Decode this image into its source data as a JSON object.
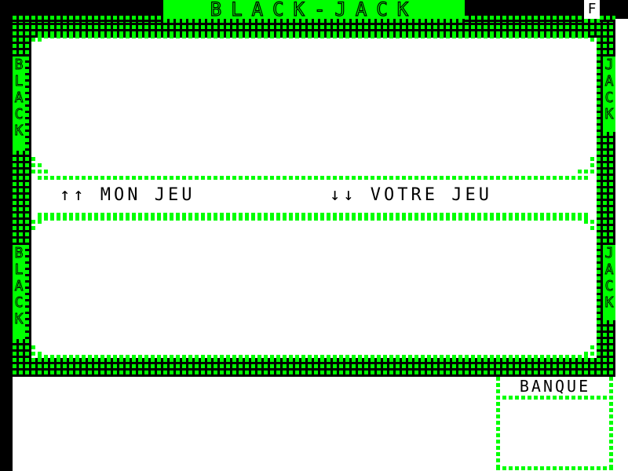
{
  "title": "BLACK-JACK",
  "corner_key": "F",
  "side_label_left": [
    "B",
    "L",
    "A",
    "C",
    "K"
  ],
  "side_label_right": [
    "J",
    "A",
    "C",
    "K"
  ],
  "dealer_label": "↑↑ MON JEU",
  "player_label": "↓↓ VOTRE JEU",
  "bank_label": "BANQUE",
  "colors": {
    "accent": "#00ff00",
    "background": "#ffffff",
    "frame": "#000000"
  }
}
